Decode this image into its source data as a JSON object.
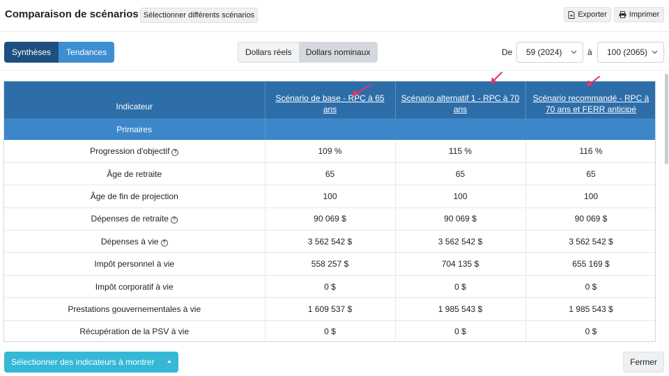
{
  "header": {
    "title": "Comparaison de scénarios",
    "select_scenarios_label": "Sélectionner différents scénarios",
    "export_label": "Exporter",
    "print_label": "Imprimer"
  },
  "toolbar": {
    "view_tabs": [
      "Synthèses",
      "Tendances"
    ],
    "dollar_tabs": [
      "Dollars réels",
      "Dollars nominaux"
    ],
    "from_label": "De",
    "from_value": "59 (2024)",
    "to_label": "à",
    "to_value": "100 (2065)"
  },
  "table": {
    "headers": [
      "Indicateur",
      "Scénario de base - RPC à 65 ans",
      "Scénario alternatif 1 - RPC à 70 ans",
      "Scénario recommandé - RPC à 70 ans et FERR anticipé"
    ],
    "group_label": "Primaires",
    "rows": [
      {
        "label": "Progression d'objectif",
        "help": true,
        "values": [
          "109 %",
          "115 %",
          "116 %"
        ]
      },
      {
        "label": "Âge de retraite",
        "help": false,
        "values": [
          "65",
          "65",
          "65"
        ]
      },
      {
        "label": "Âge de fin de projection",
        "help": false,
        "values": [
          "100",
          "100",
          "100"
        ]
      },
      {
        "label": "Dépenses de retraite",
        "help": true,
        "values": [
          "90 069 $",
          "90 069 $",
          "90 069 $"
        ]
      },
      {
        "label": "Dépenses à vie",
        "help": true,
        "values": [
          "3 562 542 $",
          "3 562 542 $",
          "3 562 542 $"
        ]
      },
      {
        "label": "Impôt personnel à vie",
        "help": false,
        "values": [
          "558 257 $",
          "704 135 $",
          "655 169 $"
        ]
      },
      {
        "label": "Impôt corporatif à vie",
        "help": false,
        "values": [
          "0 $",
          "0 $",
          "0 $"
        ]
      },
      {
        "label": "Prestations gouvernementales à vie",
        "help": false,
        "values": [
          "1 609 537 $",
          "1 985 543 $",
          "1 985 543 $"
        ]
      },
      {
        "label": "Récupération de la PSV à vie",
        "help": false,
        "values": [
          "0 $",
          "0 $",
          "0 $"
        ]
      }
    ]
  },
  "footer": {
    "select_indicators_label": "Sélectionner des indicateurs à montrer",
    "close_label": "Fermer"
  },
  "colors": {
    "header_blue": "#2d6ea9",
    "group_blue": "#3d86ca",
    "active_tab": "#1e4f80",
    "inactive_tab": "#3d8fd1",
    "footer_button": "#35b8d6",
    "annotation_arrow": "#e8336b"
  },
  "icons": {
    "export": "file-export-icon",
    "print": "printer-icon",
    "help": "question-circle-icon",
    "chevron": "chevron-down-icon",
    "caret": "caret-up-icon",
    "annotation": "arrow-annotation-icon"
  }
}
